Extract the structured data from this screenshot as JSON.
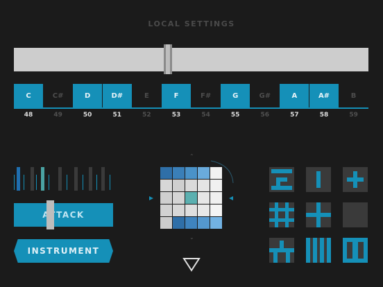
{
  "header": {
    "title": "LOCAL SETTINGS"
  },
  "slider": {
    "value_fraction": 0.43
  },
  "keyboard": {
    "keys": [
      {
        "label": "C",
        "number": "48",
        "active": true
      },
      {
        "label": "C#",
        "number": "49",
        "active": false
      },
      {
        "label": "D",
        "number": "50",
        "active": true
      },
      {
        "label": "D#",
        "number": "51",
        "active": true
      },
      {
        "label": "E",
        "number": "52",
        "active": false
      },
      {
        "label": "F",
        "number": "53",
        "active": true
      },
      {
        "label": "F#",
        "number": "54",
        "active": false
      },
      {
        "label": "G",
        "number": "55",
        "active": true
      },
      {
        "label": "G#",
        "number": "56",
        "active": false
      },
      {
        "label": "A",
        "number": "57",
        "active": true
      },
      {
        "label": "A#",
        "number": "58",
        "active": true
      },
      {
        "label": "B",
        "number": "59",
        "active": false
      }
    ]
  },
  "attack": {
    "label": "ATTACK",
    "value_fraction": 0.33
  },
  "instrument": {
    "label": "INSTRUMENT"
  },
  "colors": {
    "background": "#1b1b1b",
    "accent": "#1590b8",
    "teal": "#4aa3a3",
    "light_gray": "#cdcdcd",
    "dim_text": "#4d4d4d"
  },
  "grid": {
    "rows": [
      [
        "#2f6fa8",
        "#3a7fb8",
        "#4a92c8",
        "#6aabdc",
        "#f2f2f2"
      ],
      [
        "#d7d7d7",
        "#cfcfcf",
        "#dadada",
        "#e4e4e4",
        "#f0f0f0"
      ],
      [
        "#cfcfcf",
        "#d4d4d4",
        "#5bb0b0",
        "#e6e6e6",
        "#f0f0f0"
      ],
      [
        "#d2d2d2",
        "#d8d8d8",
        "#dfdfdf",
        "#e8e8e8",
        "#f4f4f4"
      ],
      [
        "#cccccc",
        "#2f6fa8",
        "#3f84bf",
        "#5498cf",
        "#72b2e3"
      ]
    ]
  },
  "icons": {
    "top_arrow": "caret-up-icon",
    "bottom_arrow": "caret-down-icon",
    "left_marker": "marker-left-icon",
    "right_marker": "marker-right-icon",
    "nav": "triangle-down-icon"
  },
  "patterns": [
    "pattern-bracket-icon",
    "pattern-vertical-bar-icon",
    "pattern-plus-icon",
    "pattern-lattice-icon",
    "pattern-cross-icon",
    "pattern-empty-icon",
    "pattern-split-icon",
    "pattern-stripes-icon",
    "pattern-double-frame-icon"
  ]
}
